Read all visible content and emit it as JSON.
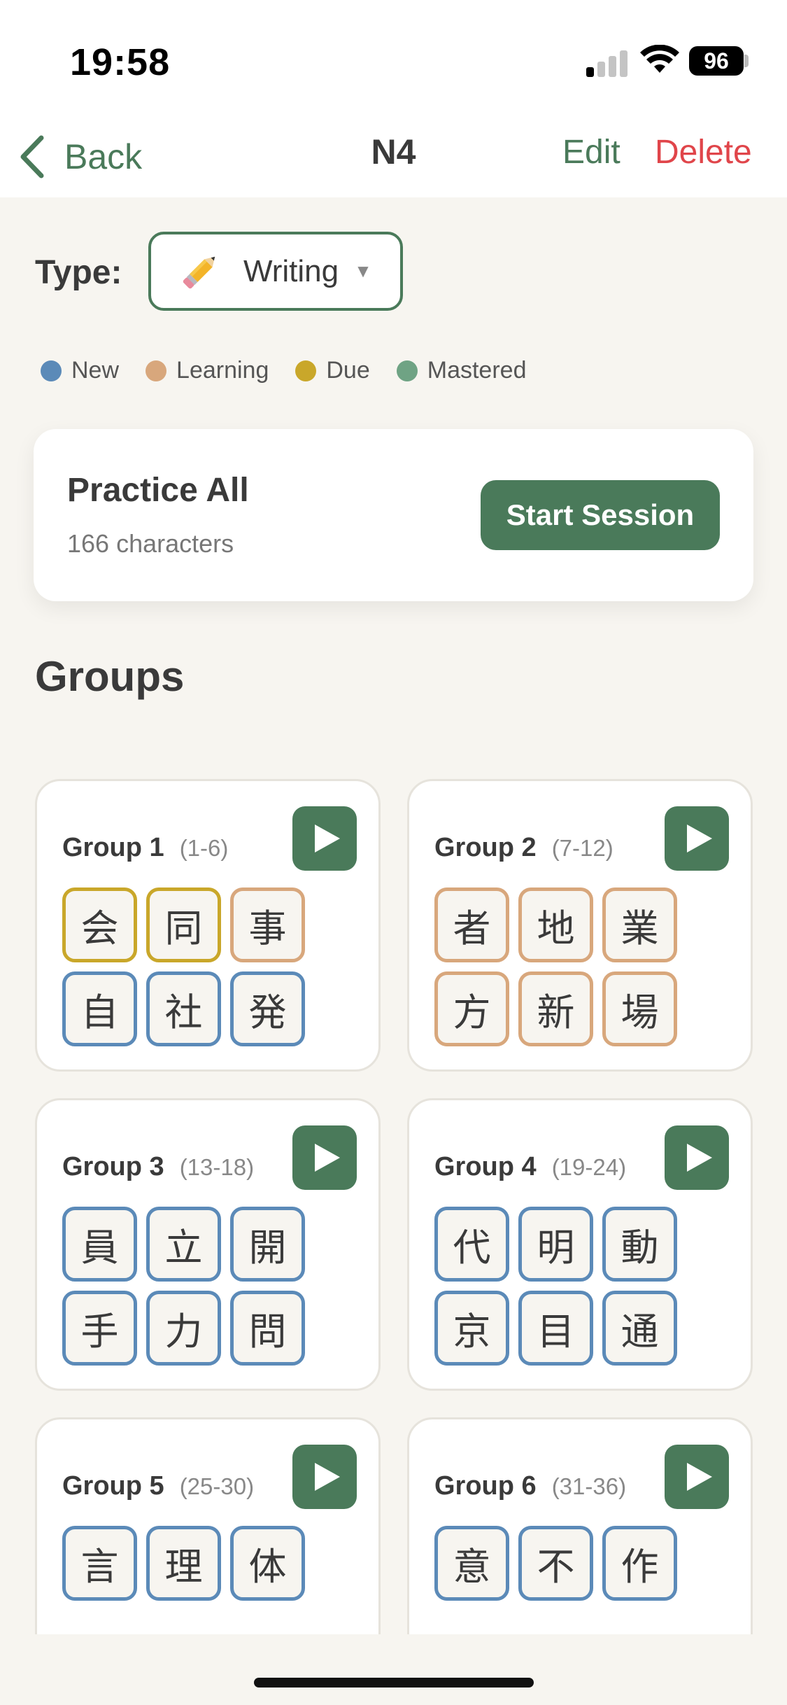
{
  "status": {
    "time": "19:58",
    "battery": "96"
  },
  "nav": {
    "back_label": "Back",
    "title": "N4",
    "edit_label": "Edit",
    "delete_label": "Delete"
  },
  "type_selector": {
    "label": "Type:",
    "value": "Writing",
    "icon": "pencil-icon"
  },
  "legend": [
    {
      "label": "New",
      "color": "#5b8ab8"
    },
    {
      "label": "Learning",
      "color": "#d8a77c"
    },
    {
      "label": "Due",
      "color": "#c9a72a"
    },
    {
      "label": "Mastered",
      "color": "#6fa384"
    }
  ],
  "practice": {
    "title": "Practice All",
    "subtitle": "166 characters",
    "button_label": "Start Session"
  },
  "groups_heading": "Groups",
  "groups": [
    {
      "name": "Group 1",
      "range": "(1-6)",
      "chars": [
        {
          "char": "会",
          "status": "due"
        },
        {
          "char": "同",
          "status": "due"
        },
        {
          "char": "事",
          "status": "learning"
        },
        {
          "char": "自",
          "status": "new"
        },
        {
          "char": "社",
          "status": "new"
        },
        {
          "char": "発",
          "status": "new"
        }
      ]
    },
    {
      "name": "Group 2",
      "range": "(7-12)",
      "chars": [
        {
          "char": "者",
          "status": "learning"
        },
        {
          "char": "地",
          "status": "learning"
        },
        {
          "char": "業",
          "status": "learning"
        },
        {
          "char": "方",
          "status": "learning"
        },
        {
          "char": "新",
          "status": "learning"
        },
        {
          "char": "場",
          "status": "learning"
        }
      ]
    },
    {
      "name": "Group 3",
      "range": "(13-18)",
      "chars": [
        {
          "char": "員",
          "status": "new"
        },
        {
          "char": "立",
          "status": "new"
        },
        {
          "char": "開",
          "status": "new"
        },
        {
          "char": "手",
          "status": "new"
        },
        {
          "char": "力",
          "status": "new"
        },
        {
          "char": "問",
          "status": "new"
        }
      ]
    },
    {
      "name": "Group 4",
      "range": "(19-24)",
      "chars": [
        {
          "char": "代",
          "status": "new"
        },
        {
          "char": "明",
          "status": "new"
        },
        {
          "char": "動",
          "status": "new"
        },
        {
          "char": "京",
          "status": "new"
        },
        {
          "char": "目",
          "status": "new"
        },
        {
          "char": "通",
          "status": "new"
        }
      ]
    },
    {
      "name": "Group 5",
      "range": "(25-30)",
      "chars": [
        {
          "char": "言",
          "status": "new"
        },
        {
          "char": "理",
          "status": "new"
        },
        {
          "char": "体",
          "status": "new"
        }
      ]
    },
    {
      "name": "Group 6",
      "range": "(31-36)",
      "chars": [
        {
          "char": "意",
          "status": "new"
        },
        {
          "char": "不",
          "status": "new"
        },
        {
          "char": "作",
          "status": "new"
        }
      ]
    }
  ]
}
